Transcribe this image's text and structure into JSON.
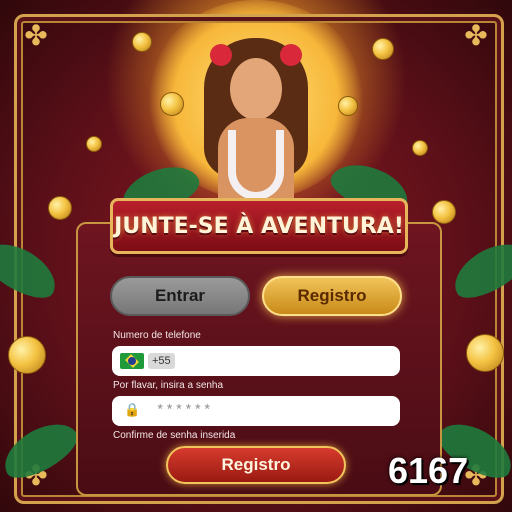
{
  "banner": {
    "title": "JUNTE-SE À AVENTURA!"
  },
  "tabs": {
    "login_label": "Entrar",
    "register_label": "Registro"
  },
  "form": {
    "phone_label": "Numero de telefone",
    "country_code": "+55",
    "password_label": "Por flavar, insira a senha",
    "password_mask": "******",
    "confirm_label": "Confirme de senha inserida"
  },
  "submit_label": "Registro",
  "badge_number": "6167",
  "colors": {
    "accent_gold": "#f1c45a",
    "panel_bg": "#6e1520",
    "submit_red": "#d63b2d"
  },
  "icons": {
    "flag": "brazil-flag-icon",
    "lock": "lock-icon"
  }
}
